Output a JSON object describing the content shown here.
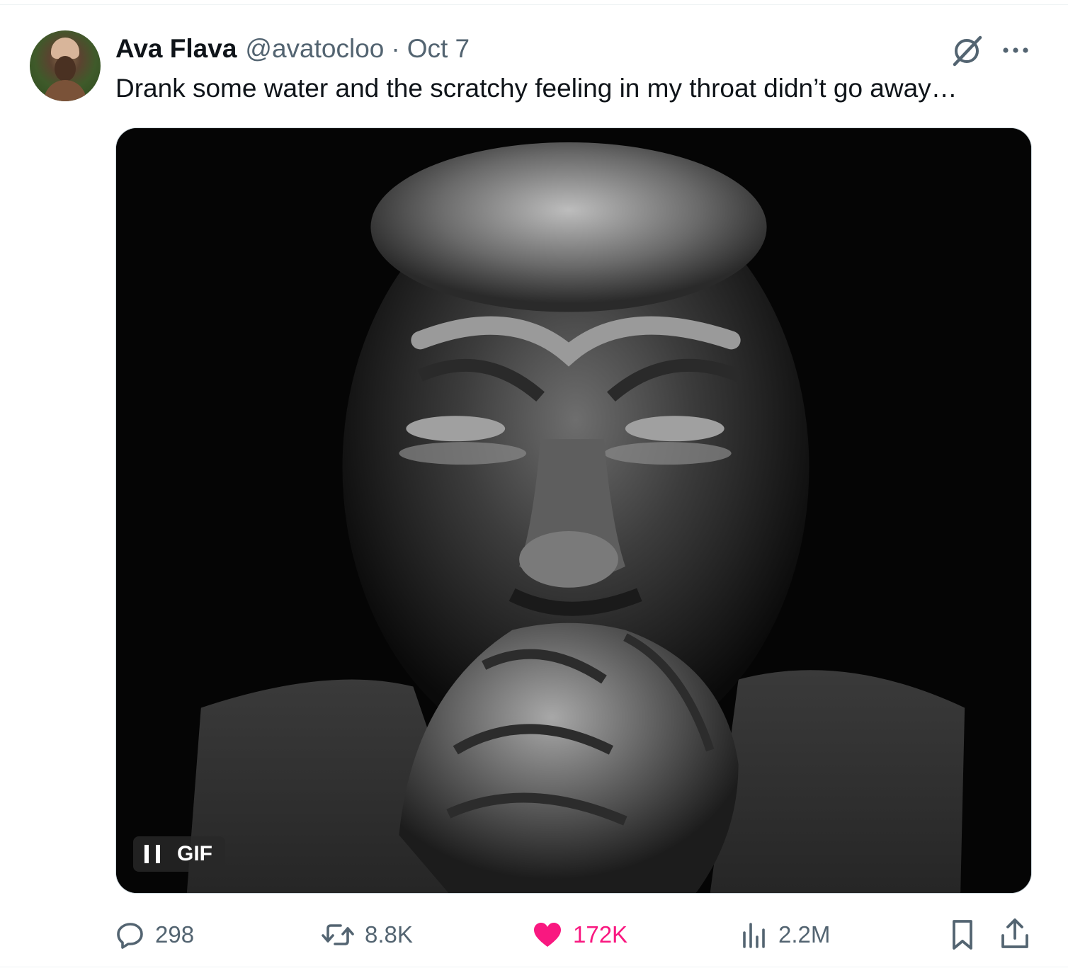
{
  "tweet": {
    "author_name": "Ava Flava",
    "handle": "@avatocloo",
    "separator": "·",
    "date": "Oct 7",
    "text": "Drank some water and the scratchy feeling in my throat didn’t go away…"
  },
  "media": {
    "badge_label": "GIF",
    "control_icon": "pause-icon"
  },
  "actions": {
    "replies": "298",
    "reposts": "8.8K",
    "likes": "172K",
    "views": "2.2M"
  },
  "icons": {
    "grok": "grok-icon",
    "more": "more-icon",
    "reply": "reply-icon",
    "retweet": "retweet-icon",
    "like": "heart-icon",
    "views": "views-icon",
    "bookmark": "bookmark-icon",
    "share": "share-icon"
  },
  "colors": {
    "text_primary": "#0f1419",
    "text_secondary": "#536471",
    "like_pink": "#f91880",
    "border": "#cfd9de"
  }
}
